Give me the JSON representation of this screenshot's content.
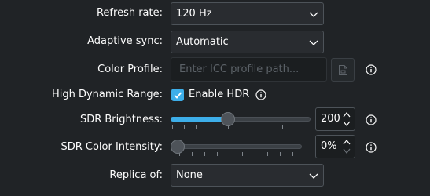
{
  "refresh_rate": {
    "label": "Refresh rate:",
    "value": "120 Hz"
  },
  "adaptive_sync": {
    "label": "Adaptive sync:",
    "value": "Automatic"
  },
  "color_profile": {
    "label": "Color Profile:",
    "placeholder": "Enter ICC profile path..."
  },
  "hdr": {
    "label": "High Dynamic Range:",
    "checkbox_label": "Enable HDR",
    "checked": true
  },
  "sdr_brightness": {
    "label": "SDR Brightness:",
    "value": "200",
    "level": 0.4
  },
  "sdr_color_intensity": {
    "label": "SDR Color Intensity:",
    "value": "0%",
    "level": 0
  },
  "replica_of": {
    "label": "Replica of:",
    "value": "None"
  },
  "colors": {
    "accent": "#3daee9",
    "background": "#202326"
  }
}
